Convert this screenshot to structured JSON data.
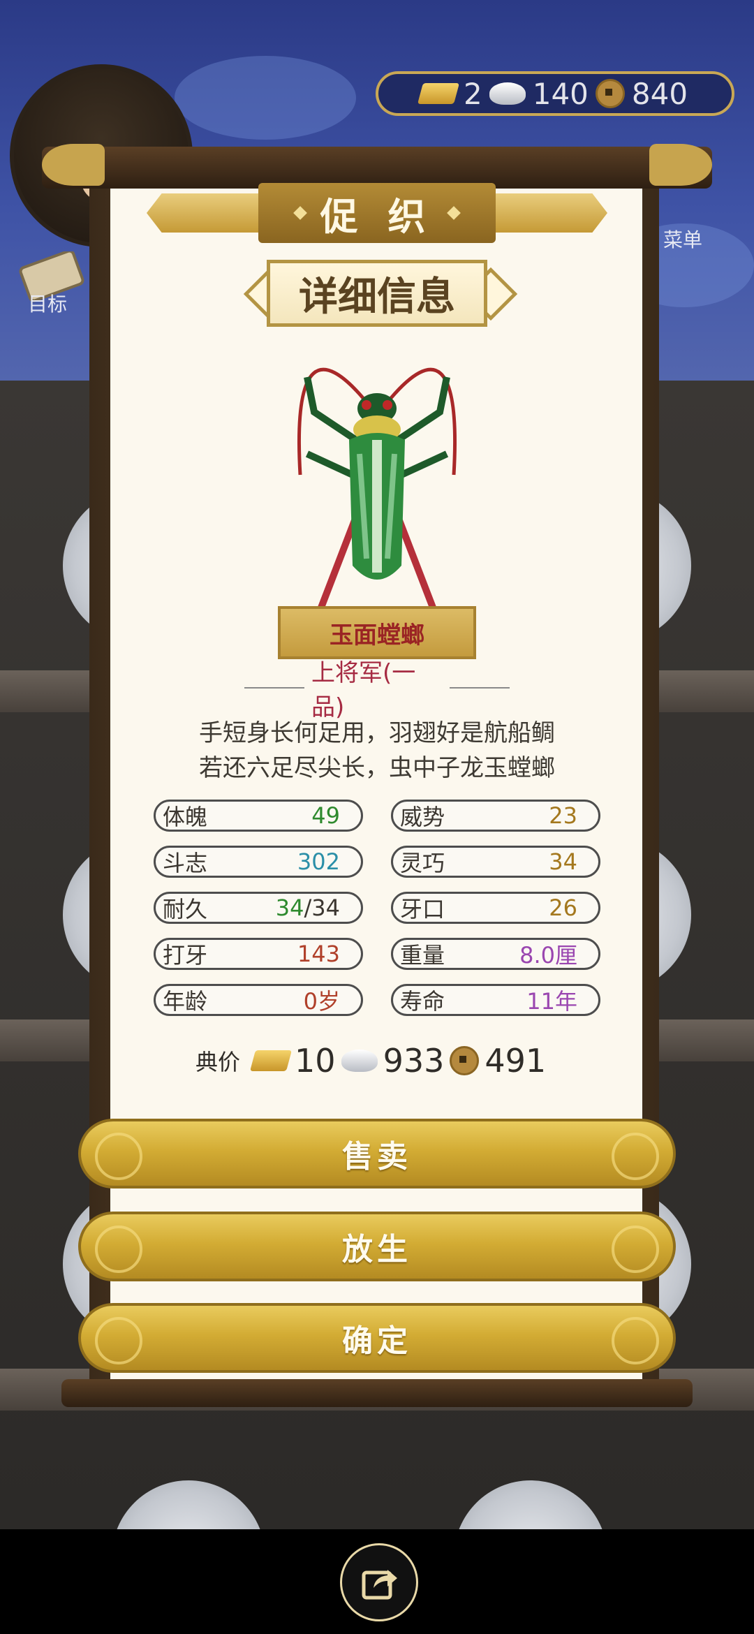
{
  "header": {
    "currency": {
      "gold": "2",
      "silver": "140",
      "copper": "840"
    },
    "nav": {
      "target_label": "目标",
      "menu_label": "菜单"
    }
  },
  "dialog": {
    "title": "促 织",
    "section": "详细信息",
    "insect": {
      "name": "玉面螳螂",
      "rank": "上将军(一品)",
      "poem": [
        "手短身长何足用，羽翅好是航船鲷",
        "若还六足尽尖长，虫中子龙玉螳螂"
      ]
    },
    "stats": [
      {
        "label": "体魄",
        "value": "49",
        "color": "#2e8a2e"
      },
      {
        "label": "威势",
        "value": "23",
        "color": "#a4781e"
      },
      {
        "label": "斗志",
        "value": "302",
        "color": "#2b8fa8"
      },
      {
        "label": "灵巧",
        "value": "34",
        "color": "#a4781e"
      },
      {
        "label": "耐久",
        "value": "34",
        "value2": "/34",
        "color": "#2e8a2e"
      },
      {
        "label": "牙口",
        "value": "26",
        "color": "#a4781e"
      },
      {
        "label": "打牙",
        "value": "143",
        "color": "#b0402a"
      },
      {
        "label": "重量",
        "value": "8.0厘",
        "color": "#9a46b0"
      },
      {
        "label": "年龄",
        "value": "0岁",
        "color": "#b0402a"
      },
      {
        "label": "寿命",
        "value": "11年",
        "color": "#9a46b0"
      }
    ],
    "price": {
      "label": "典价",
      "gold": "10",
      "silver": "933",
      "copper": "491"
    },
    "buttons": {
      "sell": "售卖",
      "release": "放生",
      "confirm": "确定"
    }
  }
}
